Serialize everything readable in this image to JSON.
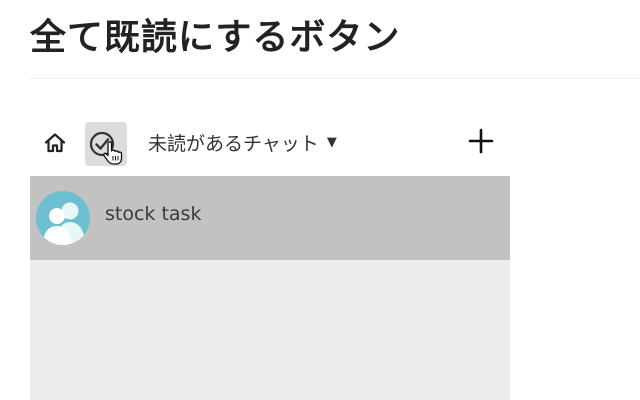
{
  "page": {
    "title": "全て既読にするボタン"
  },
  "toolbar": {
    "home_icon": "home-icon",
    "read_all_icon": "check-circle-icon",
    "cursor_icon": "hand-pointer-icon",
    "filter": {
      "selected": "未読があるチャット",
      "caret": "▼"
    },
    "add_icon": "plus-icon"
  },
  "chat_list": {
    "items": [
      {
        "name": "stock task",
        "avatar_icon": "group-avatar-icon",
        "selected": true
      }
    ]
  },
  "colors": {
    "title_text": "#222222",
    "toolbar_bg": "#ffffff",
    "button_highlight": "#dcdcdc",
    "selected_row": "#c2c2c2",
    "list_bg": "#ececec",
    "avatar_bg": "#6cbfd0"
  }
}
